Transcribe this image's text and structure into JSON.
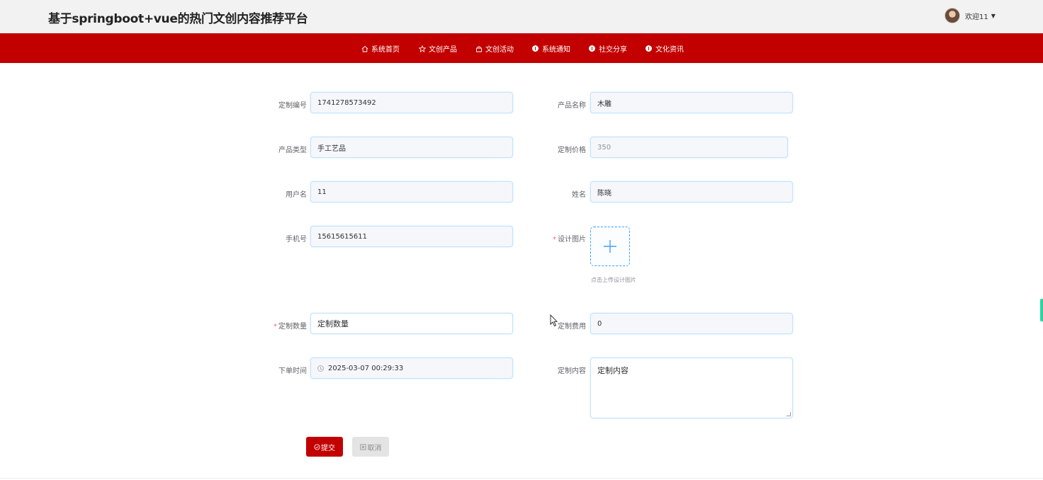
{
  "header": {
    "title": "基于springboot+vue的热门文创内容推荐平台",
    "welcome": "欢迎11",
    "caret": "▼"
  },
  "nav": [
    {
      "label": "系统首页",
      "icon": "home-icon"
    },
    {
      "label": "文创产品",
      "icon": "star-icon"
    },
    {
      "label": "文创活动",
      "icon": "bag-icon"
    },
    {
      "label": "系统通知",
      "icon": "info-icon"
    },
    {
      "label": "社交分享",
      "icon": "info-icon"
    },
    {
      "label": "文化资讯",
      "icon": "info-icon"
    }
  ],
  "form": {
    "order_no": {
      "label": "定制编号",
      "value": "1741278573492"
    },
    "product_name": {
      "label": "产品名称",
      "value": "木雕"
    },
    "product_type": {
      "label": "产品类型",
      "value": "手工艺品"
    },
    "custom_price": {
      "label": "定制价格",
      "value": "350"
    },
    "username": {
      "label": "用户名",
      "value": "11"
    },
    "name": {
      "label": "姓名",
      "value": "陈晓"
    },
    "phone": {
      "label": "手机号",
      "value": "15615615611"
    },
    "design_image": {
      "label": "设计图片",
      "tip": "点击上传设计图片",
      "required_mark": "*"
    },
    "quantity": {
      "label": "定制数量",
      "placeholder": "定制数量",
      "required_mark": "*"
    },
    "fee": {
      "label": "定制费用",
      "value": "0"
    },
    "order_time": {
      "label": "下单时间",
      "value": "2025-03-07 00:29:33"
    },
    "content": {
      "label": "定制内容",
      "value": "定制内容"
    }
  },
  "buttons": {
    "submit": "提交",
    "cancel": "取消"
  },
  "colors": {
    "brand": "#c30000",
    "input_border": "#c6e2ff",
    "upload_border": "#409eff",
    "side_tab": "#2fd3a0"
  }
}
